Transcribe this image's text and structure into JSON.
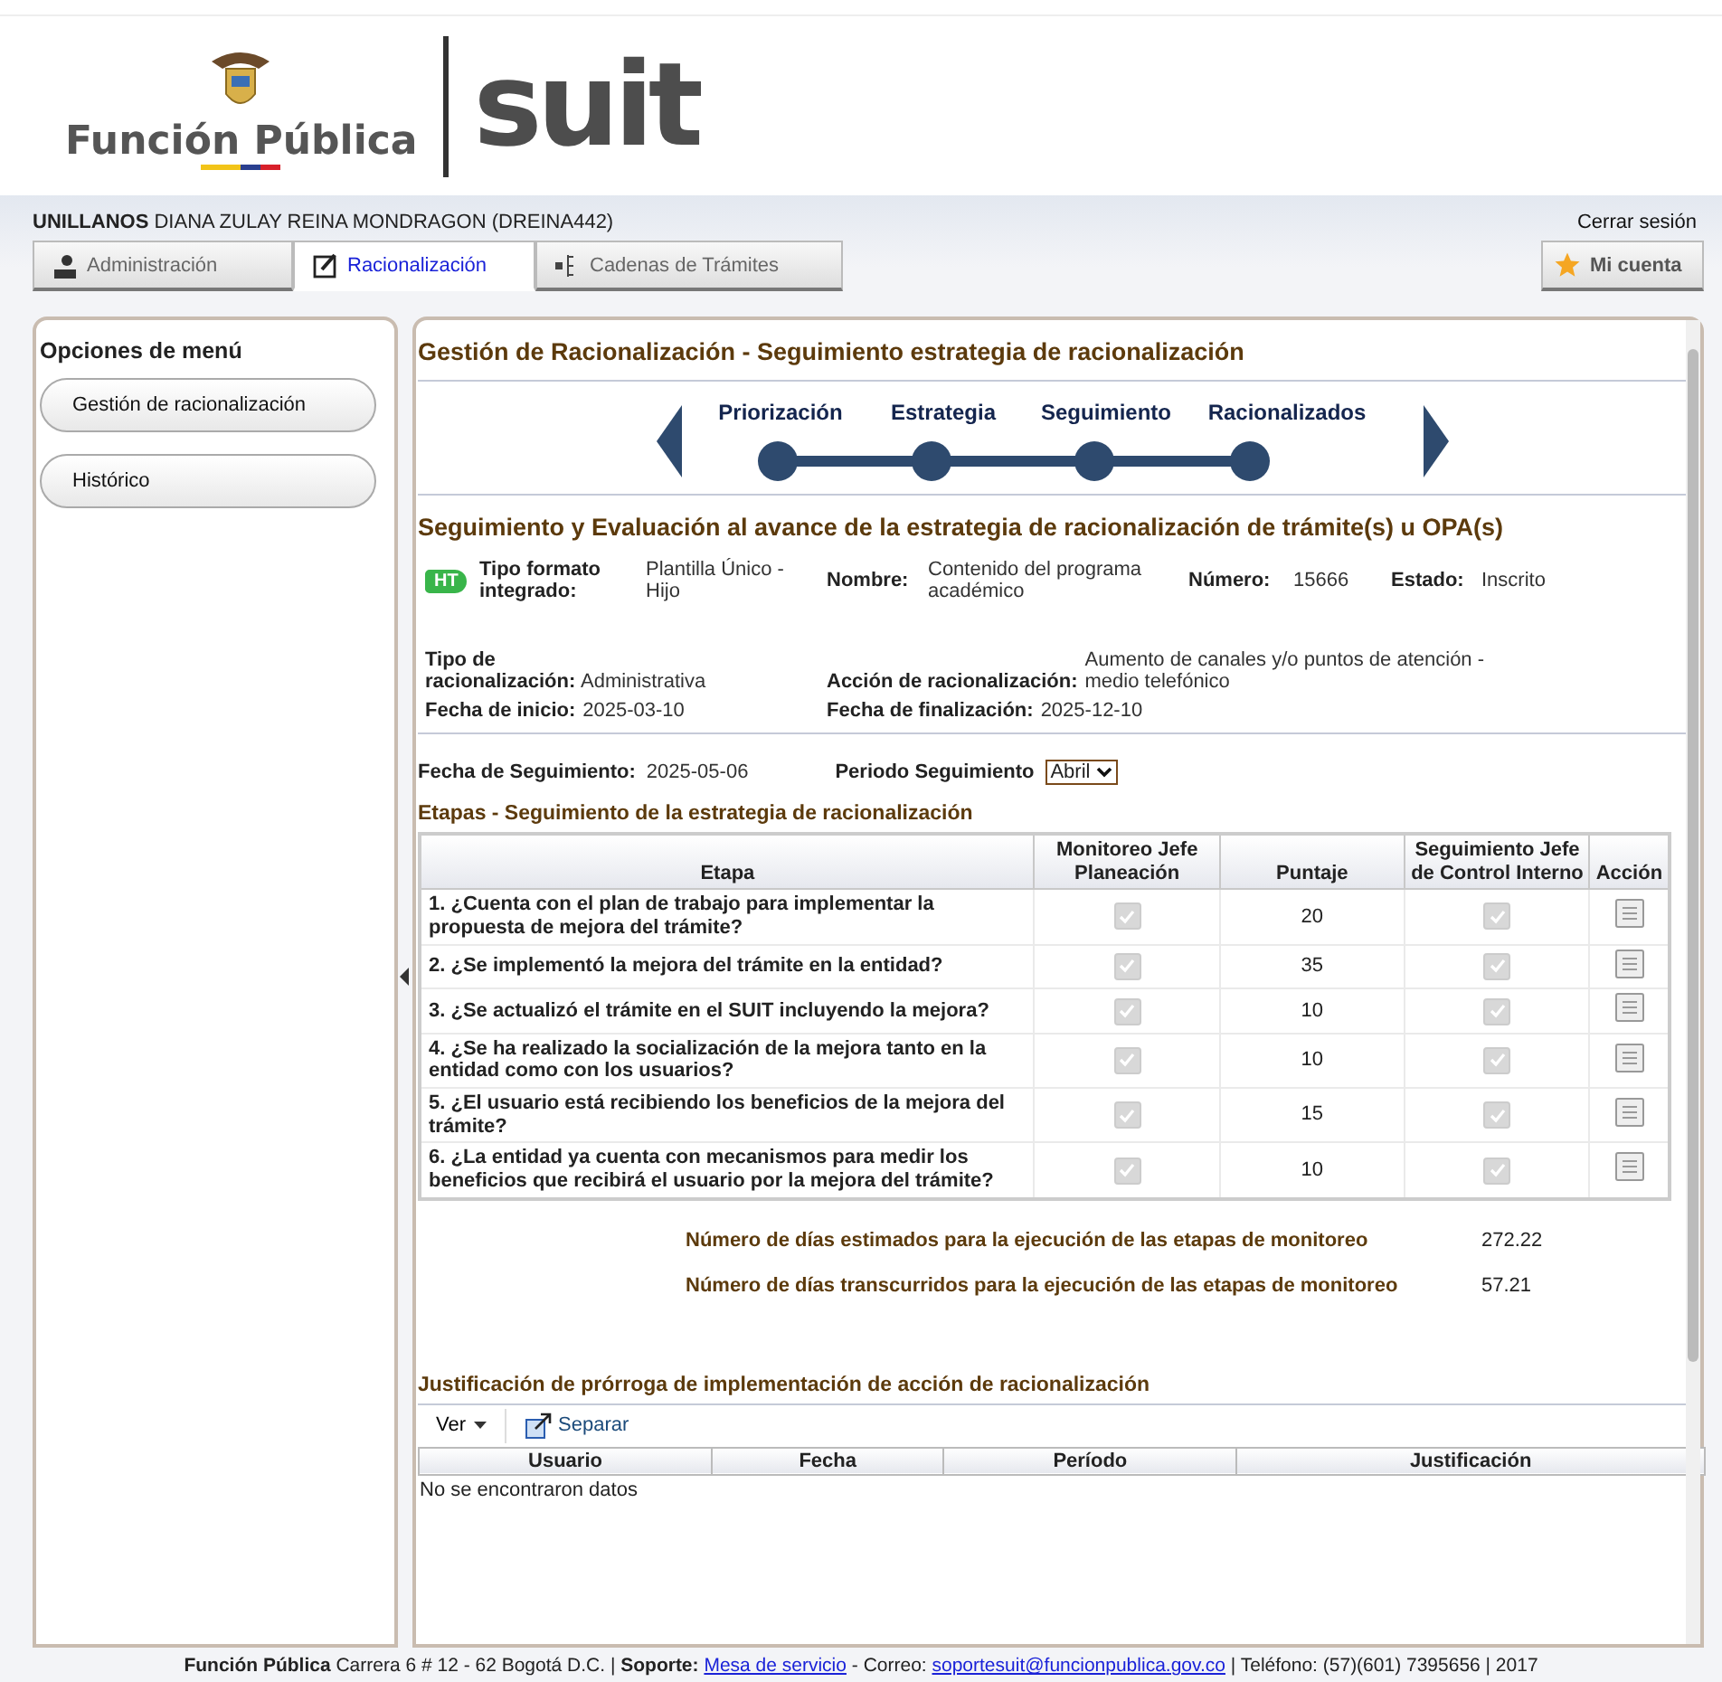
{
  "header": {
    "org_name": "Función Pública",
    "product_name": "suit"
  },
  "user_bar": {
    "entity": "UNILLANOS",
    "user": "DIANA ZULAY REINA MONDRAGON (DREINA442)",
    "logout": "Cerrar sesión"
  },
  "tabs": [
    {
      "label": "Administración",
      "selected": false
    },
    {
      "label": "Racionalización",
      "selected": true
    },
    {
      "label": "Cadenas de Trámites",
      "selected": false
    }
  ],
  "account_button": "Mi cuenta",
  "sidebar": {
    "title": "Opciones de menú",
    "items": [
      {
        "label": "Gestión de racionalización",
        "selected": false
      },
      {
        "label": "Histórico",
        "selected": false
      }
    ]
  },
  "main": {
    "title": "Gestión de Racionalización - Seguimiento estrategia de racionalización",
    "steps": [
      {
        "label": "Priorización"
      },
      {
        "label": "Estrategia"
      },
      {
        "label": "Seguimiento"
      },
      {
        "label": "Racionalizados"
      }
    ],
    "section_title": "Seguimiento y Evaluación al avance de la estrategia de racionalización de trámite(s) u OPA(s)",
    "badge": "HT",
    "info": [
      {
        "label": "Tipo formato integrado:",
        "value": "Plantilla Único - Hijo"
      },
      {
        "label": "Nombre:",
        "value": "Contenido del programa académico"
      },
      {
        "label": "Número:",
        "value": "15666"
      },
      {
        "label": "Estado:",
        "value": "Inscrito"
      }
    ],
    "details": [
      {
        "label": "Tipo de racionalización:",
        "value": "Administrativa"
      },
      {
        "label": "Acción de racionalización:",
        "value": "Aumento de canales y/o puntos de atención - medio telefónico"
      },
      {
        "label": "Fecha de inicio:",
        "value": "2025-03-10"
      },
      {
        "label": "Fecha de finalización:",
        "value": "2025-12-10"
      }
    ],
    "tracking_date_label": "Fecha de Seguimiento:",
    "tracking_date": "2025-05-06",
    "period_label": "Periodo Seguimiento",
    "period_value": "Abril",
    "stages_title": "Etapas - Seguimiento de la estrategia de racionalización",
    "stages_columns": [
      "Etapa",
      "Monitoreo Jefe Planeación",
      "Puntaje",
      "Seguimiento Jefe de Control Interno",
      "Acción"
    ],
    "stages": [
      {
        "etapa": "1. ¿Cuenta con el plan de trabajo para implementar la propuesta de mejora del trámite?",
        "planning_checked": true,
        "puntaje": "20",
        "control_checked": true
      },
      {
        "etapa": "2. ¿Se implementó la mejora del trámite en la entidad?",
        "planning_checked": true,
        "puntaje": "35",
        "control_checked": true
      },
      {
        "etapa": "3. ¿Se actualizó el trámite en el SUIT incluyendo la mejora?",
        "planning_checked": true,
        "puntaje": "10",
        "control_checked": true
      },
      {
        "etapa": "4. ¿Se ha realizado la socialización de la mejora tanto en la entidad como con los usuarios?",
        "planning_checked": true,
        "puntaje": "10",
        "control_checked": true
      },
      {
        "etapa": "5. ¿El usuario está recibiendo los beneficios de la mejora del trámite?",
        "planning_checked": true,
        "puntaje": "15",
        "control_checked": true
      },
      {
        "etapa": "6. ¿La entidad ya cuenta con mecanismos para medir los beneficios que recibirá el usuario por la mejora del trámite?",
        "planning_checked": true,
        "puntaje": "10",
        "control_checked": true
      }
    ],
    "summary": [
      {
        "label": "Número de días estimados para la ejecución de las etapas de monitoreo",
        "value": "272.22"
      },
      {
        "label": "Número de días transcurridos para la ejecución de las etapas de monitoreo",
        "value": "57.21"
      }
    ],
    "justification_title": "Justificación de prórroga de implementación de acción de racionalización",
    "toolbar": {
      "view": "Ver",
      "detach": "Separar"
    },
    "justification_columns": [
      "Usuario",
      "Fecha",
      "Período",
      "Justificación"
    ],
    "empty_message": "No se encontraron datos"
  },
  "footer": {
    "org": "Función Pública",
    "address": " Carrera 6 # 12 - 62 Bogotá D.C. | ",
    "support_label": "Soporte:",
    "support_link": "Mesa de servicio",
    "mail_label": " - Correo: ",
    "mail_link": "soportesuit@funcionpublica.gov.co",
    "phone": " | Teléfono: (57)(601) 7395656 | 2017"
  }
}
